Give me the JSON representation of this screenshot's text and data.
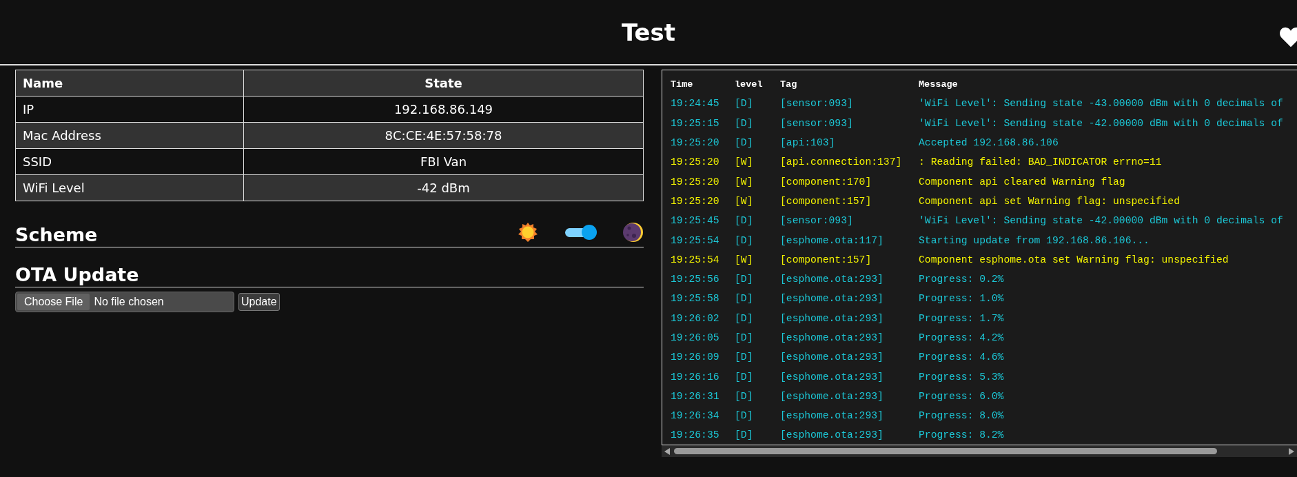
{
  "header": {
    "title": "Test"
  },
  "table": {
    "columns": [
      "Name",
      "State"
    ],
    "rows": [
      {
        "name": "IP",
        "state": "192.168.86.149"
      },
      {
        "name": "Mac Address",
        "state": "8C:CE:4E:57:58:78"
      },
      {
        "name": "SSID",
        "state": "FBI Van"
      },
      {
        "name": "WiFi Level",
        "state": "-42 dBm"
      }
    ]
  },
  "scheme": {
    "title": "Scheme",
    "dark_mode": {
      "on": true
    }
  },
  "ota": {
    "title": "OTA Update",
    "choose_button": "Choose File",
    "file_status": "No file chosen",
    "update_button": "Update"
  },
  "log": {
    "columns": [
      "Time",
      "level",
      "Tag",
      "Message"
    ],
    "rows": [
      {
        "kind": "debug",
        "time": "19:24:45",
        "level": "[D]",
        "tag": "[sensor:093]",
        "message": "'WiFi Level': Sending state -43.00000 dBm with 0 decimals of"
      },
      {
        "kind": "debug",
        "time": "19:25:15",
        "level": "[D]",
        "tag": "[sensor:093]",
        "message": "'WiFi Level': Sending state -42.00000 dBm with 0 decimals of"
      },
      {
        "kind": "debug",
        "time": "19:25:20",
        "level": "[D]",
        "tag": "[api:103]",
        "message": "Accepted 192.168.86.106"
      },
      {
        "kind": "warning",
        "time": "19:25:20",
        "level": "[W]",
        "tag": "[api.connection:137]",
        "message": ": Reading failed: BAD_INDICATOR errno=11"
      },
      {
        "kind": "warning",
        "time": "19:25:20",
        "level": "[W]",
        "tag": "[component:170]",
        "message": "Component api cleared Warning flag"
      },
      {
        "kind": "warning",
        "time": "19:25:20",
        "level": "[W]",
        "tag": "[component:157]",
        "message": "Component api set Warning flag: unspecified"
      },
      {
        "kind": "debug",
        "time": "19:25:45",
        "level": "[D]",
        "tag": "[sensor:093]",
        "message": "'WiFi Level': Sending state -42.00000 dBm with 0 decimals of"
      },
      {
        "kind": "debug",
        "time": "19:25:54",
        "level": "[D]",
        "tag": "[esphome.ota:117]",
        "message": "Starting update from 192.168.86.106..."
      },
      {
        "kind": "warning",
        "time": "19:25:54",
        "level": "[W]",
        "tag": "[component:157]",
        "message": "Component esphome.ota set Warning flag: unspecified"
      },
      {
        "kind": "debug",
        "time": "19:25:56",
        "level": "[D]",
        "tag": "[esphome.ota:293]",
        "message": "Progress: 0.2%"
      },
      {
        "kind": "debug",
        "time": "19:25:58",
        "level": "[D]",
        "tag": "[esphome.ota:293]",
        "message": "Progress: 1.0%"
      },
      {
        "kind": "debug",
        "time": "19:26:02",
        "level": "[D]",
        "tag": "[esphome.ota:293]",
        "message": "Progress: 1.7%"
      },
      {
        "kind": "debug",
        "time": "19:26:05",
        "level": "[D]",
        "tag": "[esphome.ota:293]",
        "message": "Progress: 4.2%"
      },
      {
        "kind": "debug",
        "time": "19:26:09",
        "level": "[D]",
        "tag": "[esphome.ota:293]",
        "message": "Progress: 4.6%"
      },
      {
        "kind": "debug",
        "time": "19:26:16",
        "level": "[D]",
        "tag": "[esphome.ota:293]",
        "message": "Progress: 5.3%"
      },
      {
        "kind": "debug",
        "time": "19:26:31",
        "level": "[D]",
        "tag": "[esphome.ota:293]",
        "message": "Progress: 6.0%"
      },
      {
        "kind": "debug",
        "time": "19:26:34",
        "level": "[D]",
        "tag": "[esphome.ota:293]",
        "message": "Progress: 8.0%"
      },
      {
        "kind": "debug",
        "time": "19:26:35",
        "level": "[D]",
        "tag": "[esphome.ota:293]",
        "message": "Progress: 8.2%"
      }
    ]
  }
}
